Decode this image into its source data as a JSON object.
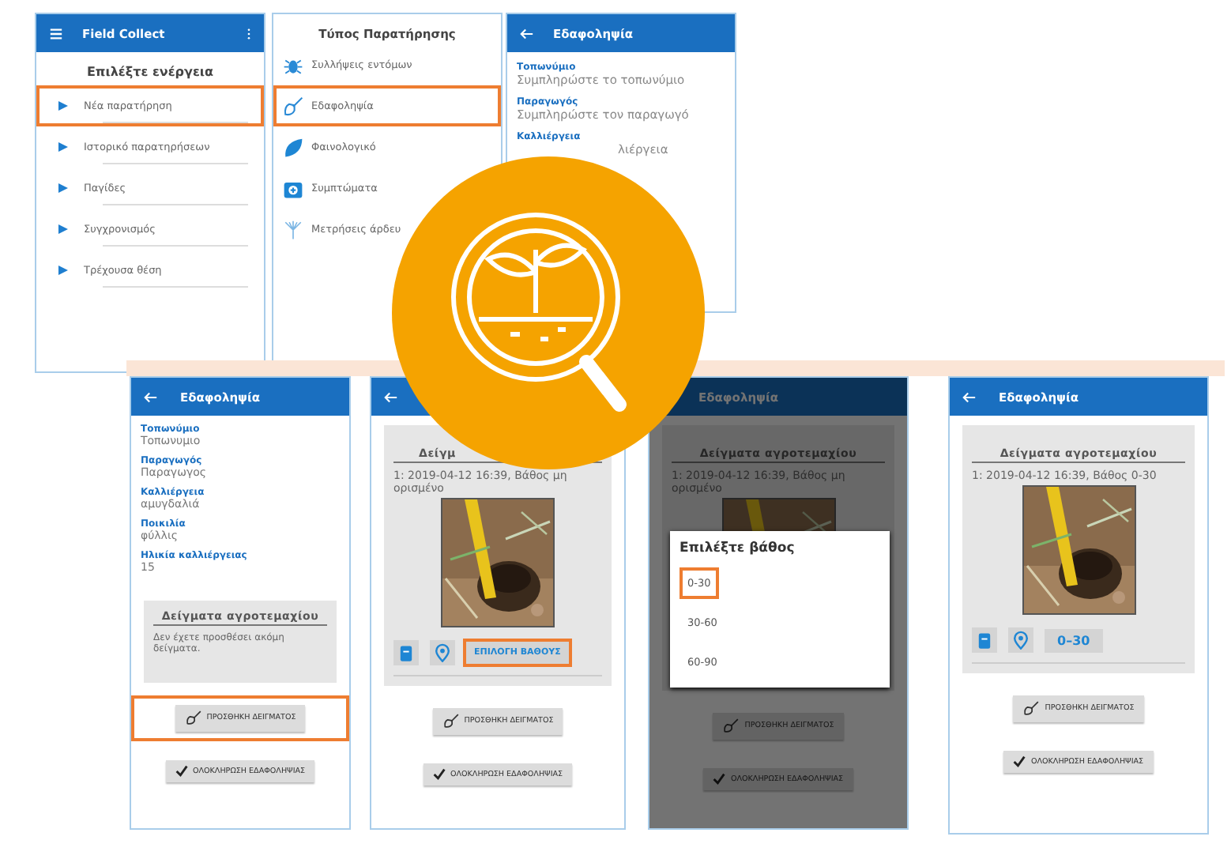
{
  "top_screens": [
    {
      "kind": "menu",
      "title": "Field Collect",
      "heading": "Επιλέξτε ενέργεια",
      "items": [
        {
          "label": "Νέα παρατήρηση",
          "highlighted": true
        },
        {
          "label": "Ιστορικό παρατηρήσεων",
          "highlighted": false
        },
        {
          "label": "Παγίδες",
          "highlighted": false
        },
        {
          "label": "Συγχρονισμός",
          "highlighted": false
        },
        {
          "label": "Τρέχουσα θέση",
          "highlighted": false
        }
      ]
    },
    {
      "kind": "types",
      "heading": "Τύπος Παρατήρησης",
      "items": [
        {
          "label": "Συλλήψεις εντόμων",
          "highlighted": false
        },
        {
          "label": "Εδαφοληψία",
          "highlighted": true
        },
        {
          "label": "Φαινολογικό",
          "highlighted": false
        },
        {
          "label": "Συμπτώματα",
          "highlighted": false
        },
        {
          "label": "Μετρήσεις άρδευ",
          "highlighted": false
        }
      ]
    },
    {
      "kind": "form",
      "title": "Εδαφοληψία",
      "fields": [
        {
          "label": "Τοπωνύμιο",
          "placeholder": "Συμπληρώστε το τοπωνύμιο"
        },
        {
          "label": "Παραγωγός",
          "placeholder": "Συμπληρώστε τον παραγωγό"
        },
        {
          "label": "Καλλιέργεια",
          "placeholder": "λιέργεια"
        }
      ]
    }
  ],
  "bottom_screens": [
    {
      "title": "Εδαφοληψία",
      "dimmed": false,
      "fields": [
        {
          "label": "Τοπωνύμιο",
          "value": "Τοπωνυμιο"
        },
        {
          "label": "Παραγωγός",
          "value": "Παραγωγος"
        },
        {
          "label": "Καλλιέργεια",
          "value": "αμυγδαλιά"
        },
        {
          "label": "Ποικιλία",
          "value": "φύλλις"
        },
        {
          "label": "Ηλικία καλλιέργειας",
          "value": "15"
        }
      ],
      "samples": {
        "heading": "Δείγματα αγροτεμαχίου",
        "empty_text": "Δεν έχετε προσθέσει ακόμη δείγματα."
      },
      "add_button": {
        "label": "ΠΡΟΣΘΗΚΗ ΔΕΙΓΜΑΤΟΣ",
        "highlighted": true
      },
      "finish_button": {
        "label": "ΟΛΟΚΛΗΡΩΣΗ ΕΔΑΦΟΛΗΨΙΑΣ"
      }
    },
    {
      "dimmed": false,
      "samples": {
        "heading": "Δείγμ",
        "entry": "1: 2019-04-12 16:39, Βάθος μη ορισμένο",
        "depth_button": {
          "label": "ΕΠΙΛΟΓΗ ΒΑΘΟΥΣ",
          "highlighted": true
        }
      },
      "add_button": {
        "label": "ΠΡΟΣΘΗΚΗ ΔΕΙΓΜΑΤΟΣ",
        "highlighted": false
      },
      "finish_button": {
        "label": "ΟΛΟΚΛΗΡΩΣΗ ΕΔΑΦΟΛΗΨΙΑΣ"
      }
    },
    {
      "title": "Εδαφοληψία",
      "dimmed": true,
      "samples": {
        "heading": "Δείγματα αγροτεμαχίου",
        "entry": "1: 2019-04-12 16:39, Βάθος μη ορισμένο"
      },
      "dialog": {
        "title": "Επιλέξτε βάθος",
        "options": [
          {
            "label": "0-30",
            "highlighted": true
          },
          {
            "label": "30-60",
            "highlighted": false
          },
          {
            "label": "60-90",
            "highlighted": false
          }
        ]
      },
      "add_button": {
        "label": "ΠΡΟΣΘΗΚΗ ΔΕΙΓΜΑΤΟΣ",
        "highlighted": false
      },
      "finish_button": {
        "label": "ΟΛΟΚΛΗΡΩΣΗ ΕΔΑΦΟΛΗΨΙΑΣ"
      }
    },
    {
      "title": "Εδαφοληψία",
      "dimmed": false,
      "samples": {
        "heading": "Δείγματα αγροτεμαχίου",
        "entry": "1: 2019-04-12 16:39, Βάθος 0-30",
        "depth_button": {
          "label": "0–30",
          "highlighted": false
        }
      },
      "add_button": {
        "label": "ΠΡΟΣΘΗΚΗ ΔΕΙΓΜΑΤΟΣ",
        "highlighted": false
      },
      "finish_button": {
        "label": "ΟΛΟΚΛΗΡΩΣΗ ΕΔΑΦΟΛΗΨΙΑΣ"
      }
    }
  ]
}
